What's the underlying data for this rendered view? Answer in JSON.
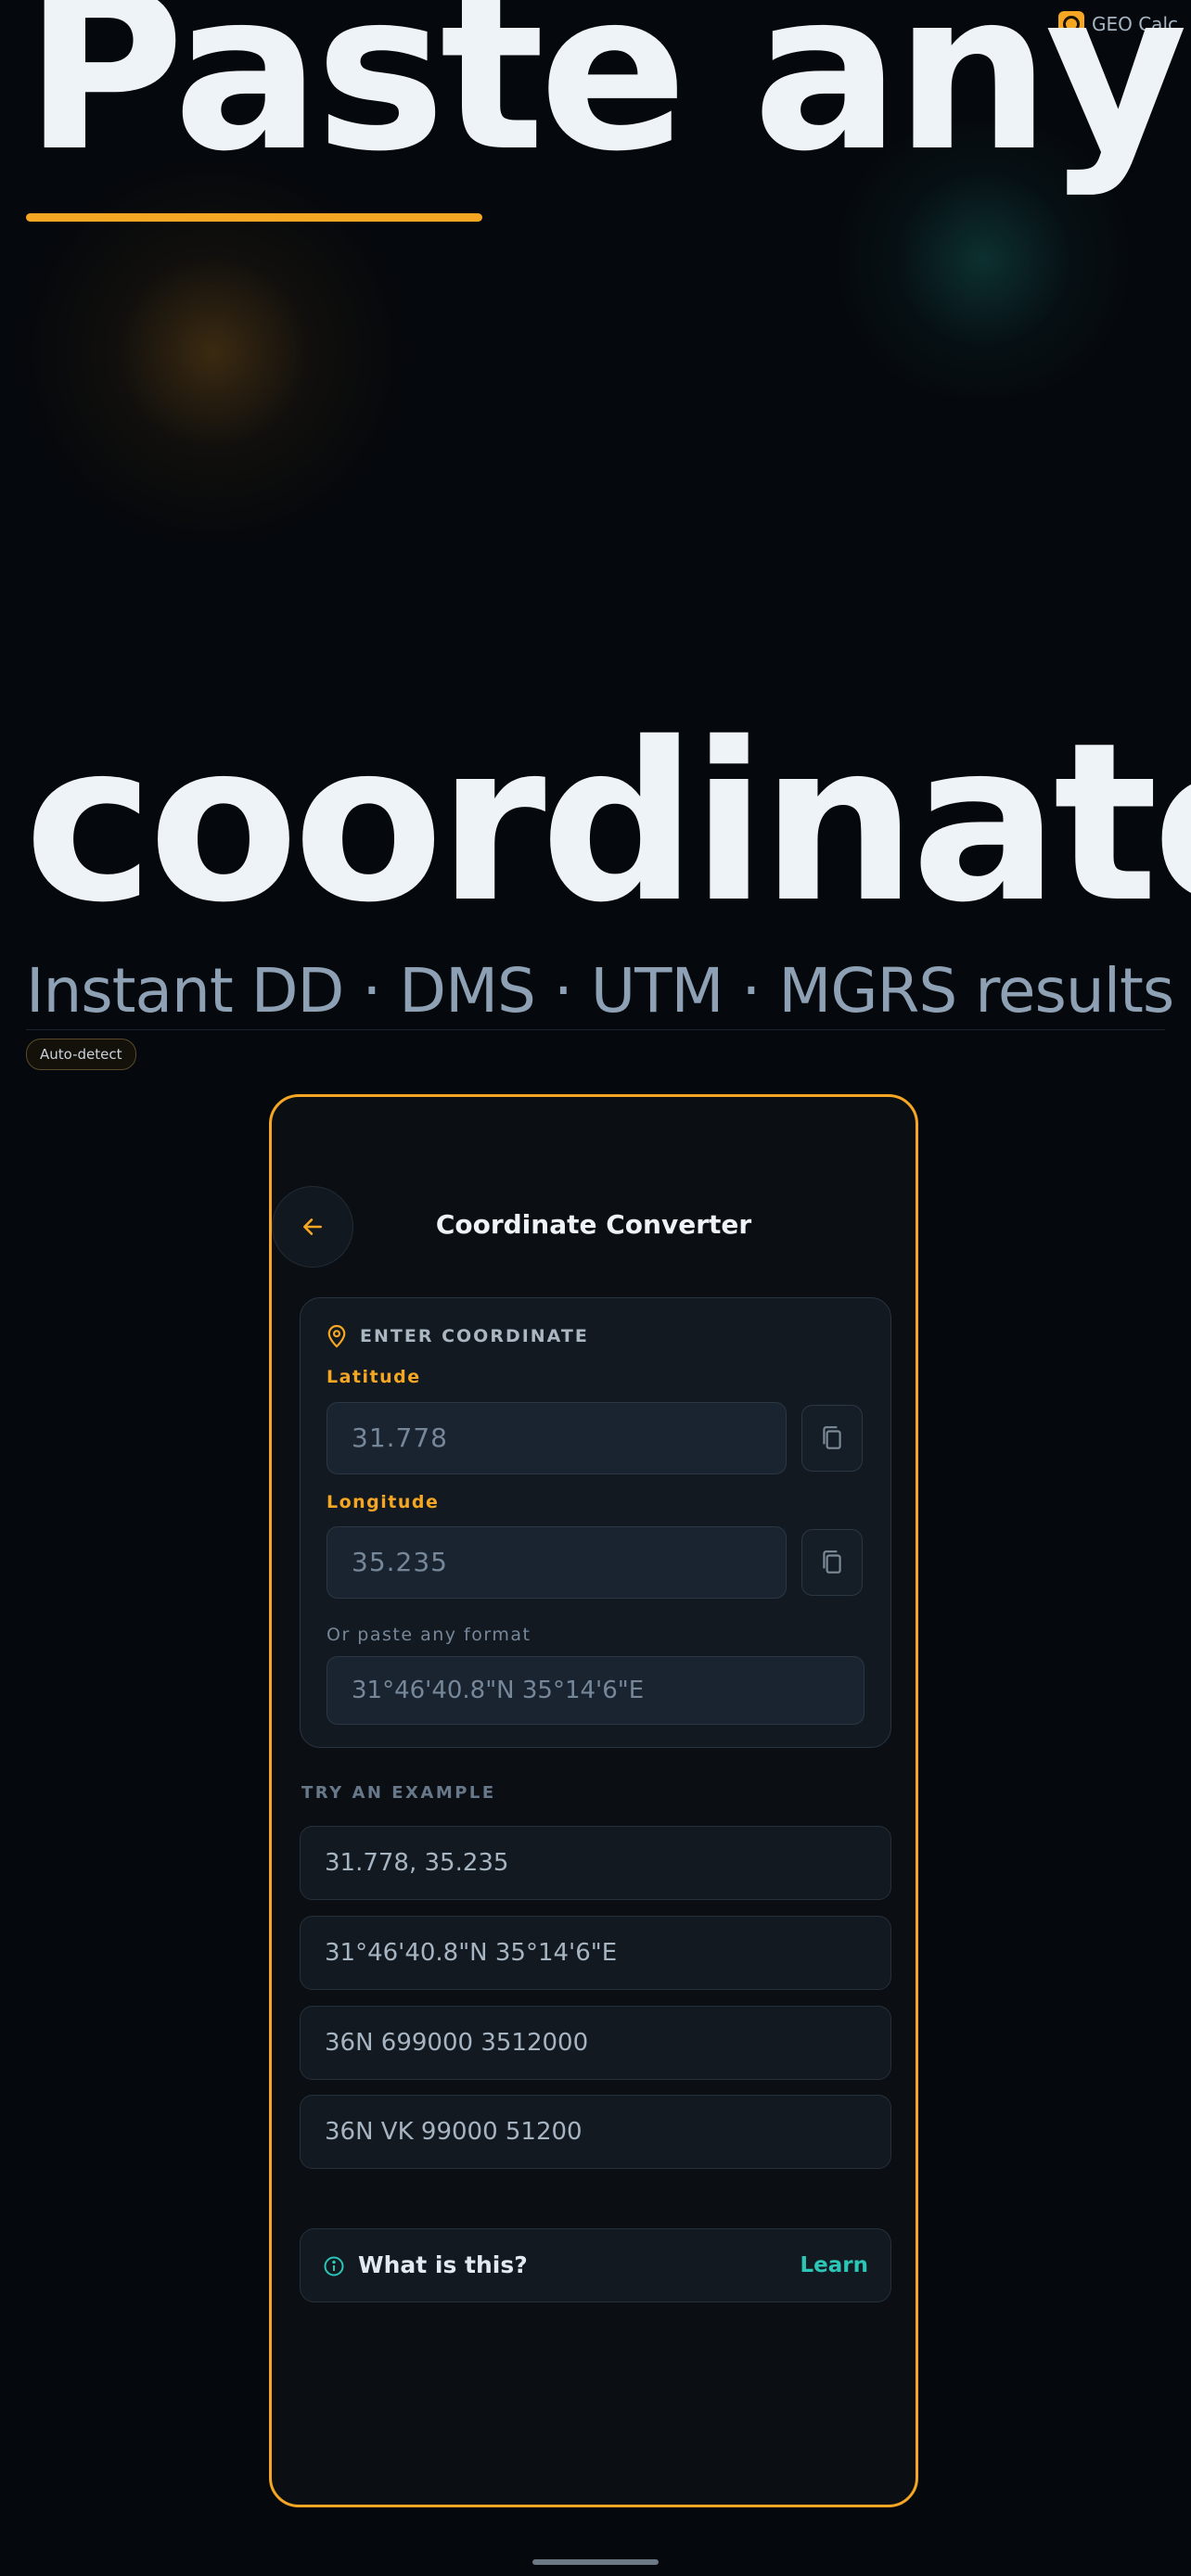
{
  "brand": {
    "name": "GEO Calc"
  },
  "hero": {
    "line1": "Paste any",
    "line2": "coordinate",
    "tagline": "Instant DD · DMS · UTM · MGRS results",
    "badge": "Auto-detect"
  },
  "screen": {
    "title": "Coordinate Converter",
    "back_icon": "arrow-left-icon"
  },
  "entry_card": {
    "heading": "ENTER COORDINATE",
    "heading_icon": "map-pin-icon",
    "latitude": {
      "label": "Latitude",
      "value": "31.778"
    },
    "longitude": {
      "label": "Longitude",
      "value": "35.235"
    },
    "copy_icon": "copy-icon",
    "paste": {
      "label": "Or paste any format",
      "placeholder": "31°46'40.8\"N 35°14'6\"E"
    }
  },
  "examples": {
    "label": "TRY AN EXAMPLE",
    "items": [
      "31.778, 35.235",
      "31°46'40.8\"N 35°14'6\"E",
      "36N 699000 3512000",
      "36N VK 99000 51200"
    ]
  },
  "info": {
    "icon": "info-icon",
    "text": "What is this?",
    "link": "Learn"
  },
  "colors": {
    "accent": "#f5a623",
    "teal": "#2cc5b6",
    "background": "#05080c"
  }
}
